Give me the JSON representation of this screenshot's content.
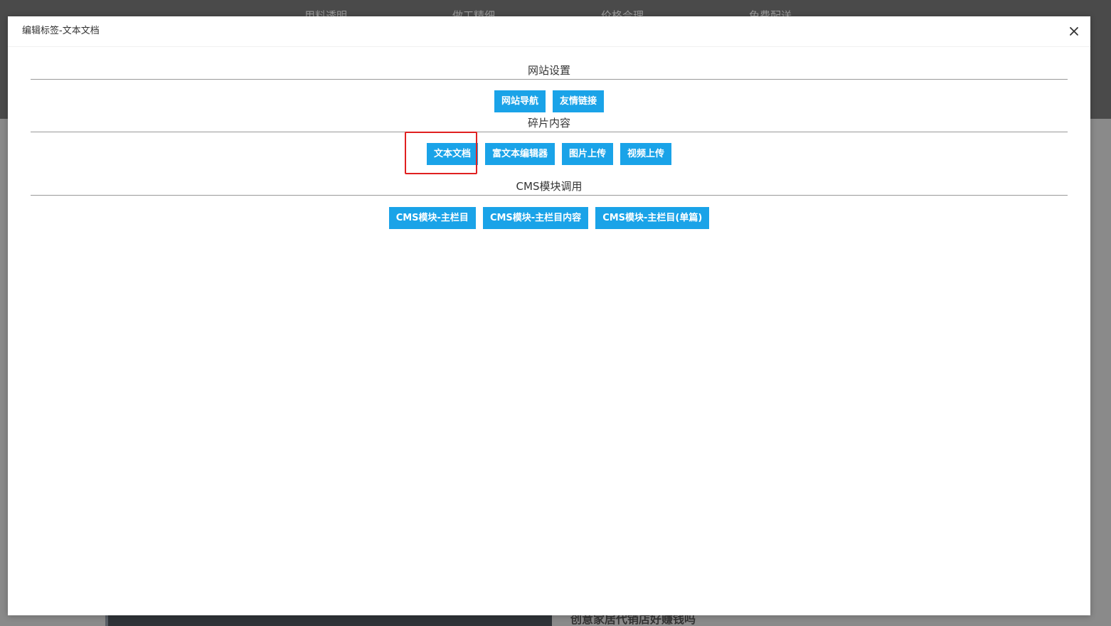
{
  "background": {
    "nav_items": [
      "用料透明",
      "做工精细",
      "价格合理",
      "免费配送"
    ],
    "article_title": "创意家居代销店好赚钱吗"
  },
  "modal": {
    "title": "编辑标签-文本文档",
    "close_icon": "close-icon"
  },
  "sections": [
    {
      "title": "网站设置",
      "buttons": [
        "网站导航",
        "友情链接"
      ]
    },
    {
      "title": "碎片内容",
      "buttons": [
        "文本文档",
        "富文本编辑器",
        "图片上传",
        "视频上传"
      ]
    },
    {
      "title": "CMS模块调用",
      "buttons": [
        "CMS模块-主栏目",
        "CMS模块-主栏目内容",
        "CMS模块-主栏目(单篇)"
      ]
    }
  ],
  "colors": {
    "button_bg": "#1aa3e8",
    "highlight": "#e02020"
  }
}
